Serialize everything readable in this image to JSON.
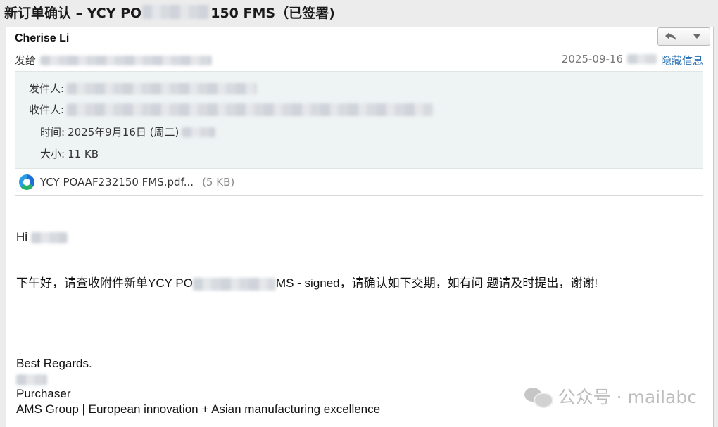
{
  "window": {
    "subject_prefix": "新订单确认 – YCY PO",
    "subject_suffix": "150 FMS（已签署)"
  },
  "header": {
    "sender_name": "Cherise Li",
    "to_label": "发给",
    "date": "2025-09-16",
    "hide_info_label": "隐藏信息",
    "reply_icon": "reply-arrow-icon",
    "more_icon": "chevron-down-icon"
  },
  "details": {
    "from_label": "发件人:",
    "to_label": "收件人:",
    "time_label": "时间:",
    "time_value": "2025年9月16日 (周二)",
    "size_label": "大小:",
    "size_value": "11 KB"
  },
  "attachment": {
    "icon": "edge-pdf-icon",
    "name": "YCY POAAF232150 FMS.pdf...",
    "size": "(5 KB)"
  },
  "body": {
    "greeting": "Hi",
    "line1_prefix": "下午好，请查收附件新单YCY PO",
    "line1_suffix": "MS - signed，请确认如下交期，如有问  题请及时提出，谢谢!",
    "regards": "Best Regards.",
    "title": "Purchaser",
    "company": "AMS Group | European innovation + Asian manufacturing excellence"
  },
  "watermark": {
    "text": "公众号 · mailabc"
  }
}
